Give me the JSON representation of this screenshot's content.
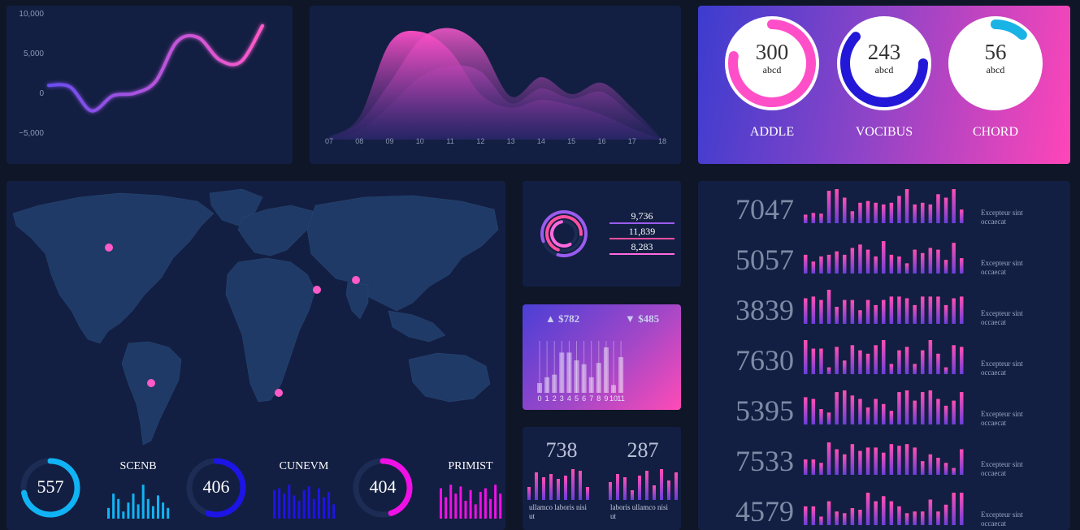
{
  "line_chart": {
    "chart_data": {
      "type": "line",
      "y_ticks": [
        "10,000",
        "5,000",
        "0",
        "−5,000"
      ],
      "ylim": [
        -7000,
        10000
      ],
      "x": [
        0,
        1,
        2,
        3,
        4,
        5,
        6,
        7,
        8,
        9,
        10
      ],
      "values": [
        1000,
        800,
        -2200,
        -300,
        0,
        1500,
        6500,
        7000,
        4200,
        4000,
        8500
      ],
      "grid": false,
      "legend": "none"
    }
  },
  "area_chart": {
    "chart_data": {
      "type": "area",
      "categories": [
        "07",
        "08",
        "09",
        "10",
        "11",
        "12",
        "13",
        "14",
        "15",
        "16",
        "17",
        "18"
      ],
      "series": [
        {
          "values": [
            2,
            20,
            85,
            95,
            78,
            40,
            28,
            35,
            30,
            22,
            10,
            0
          ]
        },
        {
          "values": [
            3,
            15,
            50,
            88,
            98,
            82,
            38,
            55,
            40,
            50,
            28,
            0
          ]
        },
        {
          "values": [
            1,
            8,
            30,
            55,
            65,
            60,
            32,
            45,
            36,
            42,
            22,
            0
          ]
        }
      ],
      "ylim": [
        0,
        100
      ],
      "grid": false
    }
  },
  "gauges": [
    {
      "value": "300",
      "unit": "abcd",
      "label": "ADDLE",
      "fraction": 0.78,
      "color": "#ff4fc8",
      "start_deg": 0
    },
    {
      "value": "243",
      "unit": "abcd",
      "label": "VOCIBUS",
      "fraction": 0.62,
      "color": "#2318d8",
      "start_deg": 90
    },
    {
      "value": "56",
      "unit": "abcd",
      "label": "CHORD",
      "fraction": 0.12,
      "color": "#1ab3e6",
      "start_deg": 0
    }
  ],
  "rings_panel": {
    "values": [
      "9,736",
      "11,839",
      "8,283"
    ],
    "colors": [
      "#9a5cf0",
      "#ff4fa0",
      "#ff6adf"
    ],
    "fractions": [
      0.85,
      0.7,
      0.55
    ]
  },
  "price_panel": {
    "up": "▲ $782",
    "down": "▼ $485",
    "chart_data": {
      "type": "bar",
      "categories": [
        "0",
        "1",
        "2",
        "3",
        "4",
        "5",
        "6",
        "7",
        "8",
        "9",
        "10",
        "11"
      ],
      "values": [
        15,
        24,
        28,
        62,
        62,
        50,
        44,
        24,
        46,
        70,
        12,
        55
      ],
      "ylim": [
        0,
        80
      ]
    }
  },
  "mini_bars": [
    {
      "number": "738",
      "caption": "ullamco laboris nisi ut",
      "values": [
        40,
        85,
        70,
        80,
        65,
        75,
        95,
        90,
        40
      ]
    },
    {
      "number": "287",
      "caption": "laboris ullamco nisi ut",
      "values": [
        55,
        80,
        70,
        30,
        75,
        90,
        45,
        95,
        60,
        85
      ]
    }
  ],
  "map_points": [
    {
      "label": "north-america"
    },
    {
      "label": "middle-east"
    },
    {
      "label": "south-asia"
    },
    {
      "label": "south-america"
    },
    {
      "label": "south-africa"
    }
  ],
  "bottom_stats": [
    {
      "value": "557",
      "label": "SCENB",
      "color": "#10b4f5",
      "fraction": 0.72,
      "bars": [
        30,
        70,
        55,
        20,
        45,
        70,
        40,
        95,
        55,
        35,
        65,
        45,
        30
      ]
    },
    {
      "value": "406",
      "label": "CUNEVM",
      "color": "#1d14e6",
      "fraction": 0.55,
      "bars": [
        80,
        85,
        70,
        95,
        65,
        50,
        80,
        90,
        55,
        85,
        60,
        75,
        40
      ]
    },
    {
      "value": "404",
      "label": "PRIMIST",
      "color": "#f010e6",
      "fraction": 0.45,
      "bars": [
        85,
        60,
        95,
        70,
        90,
        50,
        80,
        40,
        75,
        85,
        55,
        95,
        70
      ]
    }
  ],
  "kpi_rows": [
    {
      "number": "7047",
      "caption": "Excepteur sint occaecat",
      "bars": [
        25,
        30,
        28,
        95,
        100,
        75,
        35,
        60,
        65,
        60,
        55,
        60,
        80,
        100,
        55,
        60,
        55,
        85,
        75,
        100,
        40
      ]
    },
    {
      "number": "5057",
      "caption": "Excepteur sint occaecat",
      "bars": [
        55,
        35,
        50,
        55,
        65,
        55,
        75,
        85,
        70,
        50,
        95,
        55,
        50,
        30,
        70,
        60,
        75,
        70,
        40,
        90,
        45
      ]
    },
    {
      "number": "3839",
      "caption": "Excepteur sint occaecat",
      "bars": [
        75,
        80,
        70,
        100,
        50,
        70,
        70,
        40,
        70,
        55,
        70,
        80,
        80,
        75,
        55,
        80,
        80,
        80,
        55,
        75,
        80
      ]
    },
    {
      "number": "7630",
      "caption": "Excepteur sint occaecat",
      "bars": [
        100,
        75,
        75,
        20,
        80,
        40,
        85,
        70,
        60,
        85,
        100,
        30,
        70,
        80,
        30,
        70,
        100,
        60,
        20,
        85,
        80
      ]
    },
    {
      "number": "5395",
      "caption": "Excepteur sint occaecat",
      "bars": [
        80,
        75,
        45,
        35,
        95,
        100,
        85,
        75,
        50,
        75,
        60,
        40,
        95,
        100,
        70,
        95,
        100,
        75,
        55,
        70,
        95
      ]
    },
    {
      "number": "7533",
      "caption": "Excepteur sint occaecat",
      "bars": [
        45,
        45,
        35,
        95,
        75,
        60,
        90,
        70,
        80,
        80,
        65,
        90,
        85,
        90,
        80,
        40,
        60,
        50,
        35,
        20,
        75
      ]
    },
    {
      "number": "4579",
      "caption": "Excepteur sint occaecat",
      "bars": [
        55,
        55,
        25,
        70,
        40,
        35,
        50,
        45,
        95,
        70,
        85,
        70,
        55,
        35,
        40,
        40,
        75,
        40,
        60,
        95,
        95
      ]
    }
  ]
}
